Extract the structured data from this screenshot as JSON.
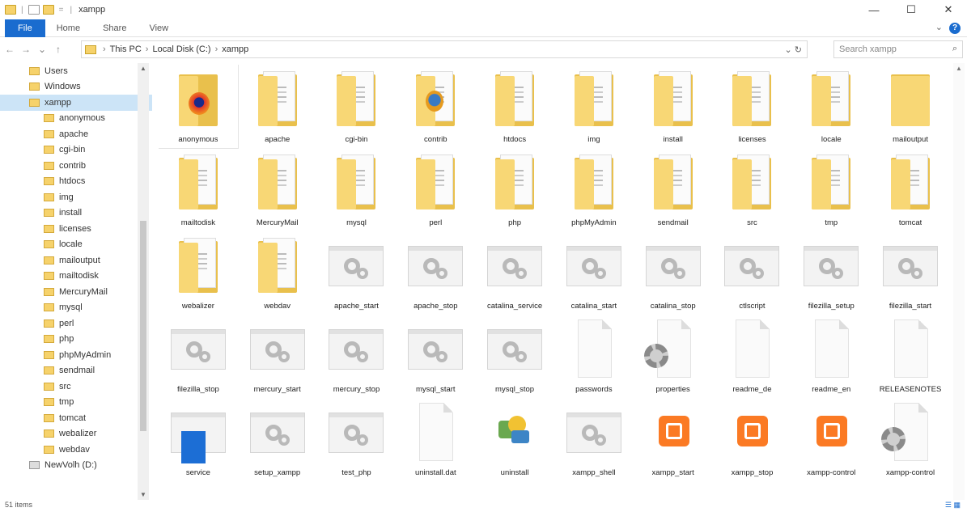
{
  "window": {
    "title": "xampp",
    "controls": {
      "minimize": "—",
      "maximize": "☐",
      "close": "✕"
    }
  },
  "ribbon": {
    "tabs": [
      "File",
      "Home",
      "Share",
      "View"
    ],
    "help": "?",
    "expand": "⌄"
  },
  "nav": {
    "back": "←",
    "forward": "→",
    "up": "↑",
    "recent": "⌄"
  },
  "address": {
    "crumbs": [
      "This PC",
      "Local Disk (C:)",
      "xampp"
    ],
    "refresh": "⌄  ↻",
    "search_placeholder": "Search xampp",
    "search_icon": "search-icon"
  },
  "sidebar": {
    "items": [
      {
        "label": "Users",
        "type": "folder"
      },
      {
        "label": "Windows",
        "type": "folder"
      },
      {
        "label": "xampp",
        "type": "folder",
        "selected": true
      },
      {
        "label": "anonymous",
        "type": "folder"
      },
      {
        "label": "apache",
        "type": "folder"
      },
      {
        "label": "cgi-bin",
        "type": "folder"
      },
      {
        "label": "contrib",
        "type": "folder"
      },
      {
        "label": "htdocs",
        "type": "folder"
      },
      {
        "label": "img",
        "type": "folder"
      },
      {
        "label": "install",
        "type": "folder"
      },
      {
        "label": "licenses",
        "type": "folder"
      },
      {
        "label": "locale",
        "type": "folder"
      },
      {
        "label": "mailoutput",
        "type": "folder"
      },
      {
        "label": "mailtodisk",
        "type": "folder"
      },
      {
        "label": "MercuryMail",
        "type": "folder"
      },
      {
        "label": "mysql",
        "type": "folder"
      },
      {
        "label": "perl",
        "type": "folder"
      },
      {
        "label": "php",
        "type": "folder"
      },
      {
        "label": "phpMyAdmin",
        "type": "folder"
      },
      {
        "label": "sendmail",
        "type": "folder"
      },
      {
        "label": "src",
        "type": "folder"
      },
      {
        "label": "tmp",
        "type": "folder"
      },
      {
        "label": "tomcat",
        "type": "folder"
      },
      {
        "label": "webalizer",
        "type": "folder"
      },
      {
        "label": "webdav",
        "type": "folder"
      },
      {
        "label": "NewVolh (D:)",
        "type": "drive"
      }
    ]
  },
  "files": [
    {
      "name": "anonymous",
      "kind": "folder-firefox",
      "selected": true
    },
    {
      "name": "apache",
      "kind": "folder"
    },
    {
      "name": "cgi-bin",
      "kind": "folder"
    },
    {
      "name": "contrib",
      "kind": "folder-img"
    },
    {
      "name": "htdocs",
      "kind": "folder"
    },
    {
      "name": "img",
      "kind": "folder"
    },
    {
      "name": "install",
      "kind": "folder"
    },
    {
      "name": "licenses",
      "kind": "folder"
    },
    {
      "name": "locale",
      "kind": "folder"
    },
    {
      "name": "mailoutput",
      "kind": "folder-plain"
    },
    {
      "name": "mailtodisk",
      "kind": "folder"
    },
    {
      "name": "MercuryMail",
      "kind": "folder"
    },
    {
      "name": "mysql",
      "kind": "folder"
    },
    {
      "name": "perl",
      "kind": "folder"
    },
    {
      "name": "php",
      "kind": "folder"
    },
    {
      "name": "phpMyAdmin",
      "kind": "folder"
    },
    {
      "name": "sendmail",
      "kind": "folder"
    },
    {
      "name": "src",
      "kind": "folder"
    },
    {
      "name": "tmp",
      "kind": "folder"
    },
    {
      "name": "tomcat",
      "kind": "folder"
    },
    {
      "name": "webalizer",
      "kind": "folder"
    },
    {
      "name": "webdav",
      "kind": "folder"
    },
    {
      "name": "apache_start",
      "kind": "exe"
    },
    {
      "name": "apache_stop",
      "kind": "exe"
    },
    {
      "name": "catalina_service",
      "kind": "exe"
    },
    {
      "name": "catalina_start",
      "kind": "exe"
    },
    {
      "name": "catalina_stop",
      "kind": "exe"
    },
    {
      "name": "ctlscript",
      "kind": "exe"
    },
    {
      "name": "filezilla_setup",
      "kind": "exe"
    },
    {
      "name": "filezilla_start",
      "kind": "exe"
    },
    {
      "name": "filezilla_stop",
      "kind": "exe"
    },
    {
      "name": "mercury_start",
      "kind": "exe"
    },
    {
      "name": "mercury_stop",
      "kind": "exe"
    },
    {
      "name": "mysql_start",
      "kind": "exe"
    },
    {
      "name": "mysql_stop",
      "kind": "exe"
    },
    {
      "name": "passwords",
      "kind": "doc"
    },
    {
      "name": "properties",
      "kind": "doc-cog"
    },
    {
      "name": "readme_de",
      "kind": "doc"
    },
    {
      "name": "readme_en",
      "kind": "doc"
    },
    {
      "name": "RELEASENOTES",
      "kind": "doc"
    },
    {
      "name": "service",
      "kind": "service"
    },
    {
      "name": "setup_xampp",
      "kind": "exe"
    },
    {
      "name": "test_php",
      "kind": "exe"
    },
    {
      "name": "uninstall.dat",
      "kind": "doc"
    },
    {
      "name": "uninstall",
      "kind": "setup"
    },
    {
      "name": "xampp_shell",
      "kind": "exe"
    },
    {
      "name": "xampp_start",
      "kind": "xampp"
    },
    {
      "name": "xampp_stop",
      "kind": "xampp"
    },
    {
      "name": "xampp-control",
      "kind": "xampp"
    },
    {
      "name": "xampp-control",
      "kind": "doc-cog"
    }
  ],
  "status": {
    "items": "51 items",
    "views": "☰ ▦"
  },
  "colors": {
    "accent": "#1a6ccf",
    "folder": "#f8d775",
    "xampp": "#fb7a24",
    "selection": "#cce4f7"
  }
}
